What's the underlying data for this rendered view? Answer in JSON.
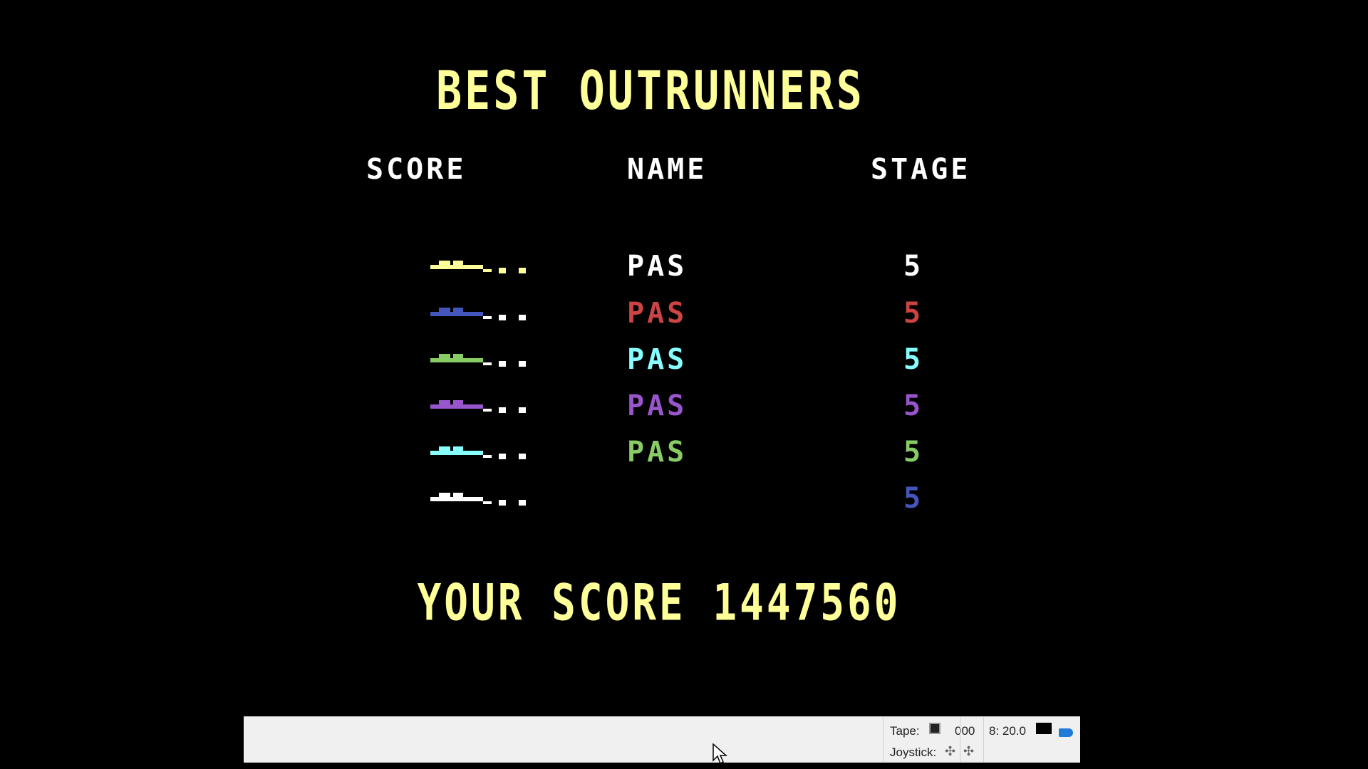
{
  "title": "BEST OUTRUNNERS",
  "headers": {
    "score": "SCORE",
    "name": "NAME",
    "stage": "STAGE"
  },
  "rows": [
    {
      "name": "PAS",
      "stage": "5",
      "color": "#ffff99"
    },
    {
      "name": "PAS",
      "stage": "5",
      "color": "#cc4444"
    },
    {
      "name": "PAS",
      "stage": "5",
      "color": "#88ffff"
    },
    {
      "name": "PAS",
      "stage": "5",
      "color": "#9955cc"
    },
    {
      "name": "PAS",
      "stage": "5",
      "color": "#88cc66"
    },
    {
      "name": "",
      "stage": "5",
      "color": "#4455bb"
    }
  ],
  "score_graphic_colors": [
    "#ffff99",
    "#4455bb",
    "#88cc66",
    "#9955cc",
    "#88ffff",
    "#ffffff"
  ],
  "your_score": "YOUR SCORE 1447560",
  "colors": {
    "title": "#ffff99",
    "header": "#ffffff"
  },
  "statusbar": {
    "tape_label": "Tape:",
    "tape_counter": "000",
    "speed": "8: 20.0",
    "joystick_label": "Joystick:",
    "joystick_icon": "joystick-icon"
  }
}
